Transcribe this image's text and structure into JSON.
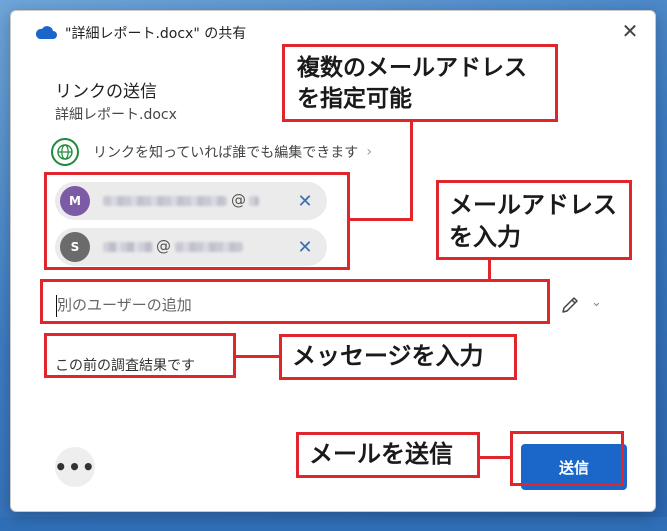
{
  "window": {
    "title": "\"詳細レポート.docx\" の共有",
    "close_glyph": "✕"
  },
  "share": {
    "heading": "リンクの送信",
    "filename": "詳細レポート.docx",
    "link_setting": "リンクを知っていれば誰でも編集できます",
    "chevron_right": "›"
  },
  "recipients": [
    {
      "initial": "M",
      "avatar_color": "#7d5aa6",
      "remove_glyph": "✕"
    },
    {
      "initial": "S",
      "avatar_color": "#6b6b6b",
      "remove_glyph": "✕"
    }
  ],
  "email_parts": {
    "at": "@"
  },
  "input": {
    "placeholder": "別のユーザーの追加"
  },
  "permission": {
    "chevron": "⌄"
  },
  "message": {
    "text": "この前の調査結果です"
  },
  "footer": {
    "more_label": "•••",
    "send_label": "送信"
  },
  "annotations": {
    "multiple_emails": "複数のメールアドレスを指定可能",
    "enter_email_line1": "メールアドレス",
    "enter_email_line2": "を入力",
    "enter_message": "メッセージを入力",
    "send_mail": "メールを送信"
  },
  "colors": {
    "accent": "#1b66c9",
    "annotation_red": "#e0262a",
    "globe_green": "#1f8a3b"
  }
}
